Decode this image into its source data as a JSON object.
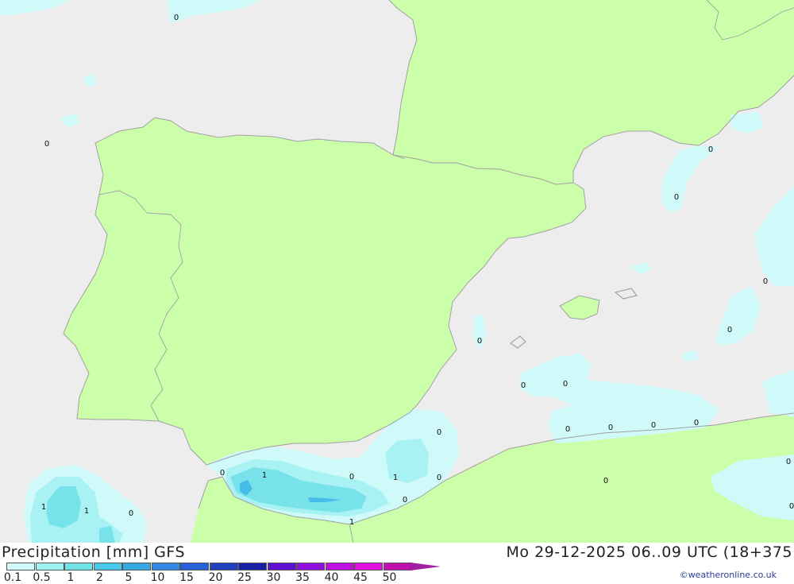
{
  "map": {
    "colors": {
      "sea": "#ededed",
      "land": "#ccffaa",
      "coast": "#a0a0a0",
      "precip_light": "#d0fafa",
      "precip_mid": "#a8f2f4",
      "precip_heavy": "#78e2ea",
      "precip_core": "#44bde8"
    },
    "contour_labels": [
      "0",
      "0",
      "0",
      "0",
      "0",
      "0",
      "0",
      "0",
      "0",
      "0",
      "0",
      "0",
      "0",
      "0",
      "0",
      "0",
      "0",
      "0",
      "0",
      "0",
      "0",
      "1",
      "1",
      "1",
      "1",
      "1",
      "0"
    ]
  },
  "footer": {
    "title": "Precipitation [mm] GFS",
    "datetime": "Mo 29-12-2025 06..09 UTC (18+375",
    "credit": "©weatheronline.co.uk"
  },
  "legend": {
    "labels": [
      "0.1",
      "0.5",
      "1",
      "2",
      "5",
      "10",
      "15",
      "20",
      "25",
      "30",
      "35",
      "40",
      "45",
      "50"
    ],
    "colors": [
      "#d0fafa",
      "#a0f0f0",
      "#70e4e4",
      "#48c8e8",
      "#38a8e0",
      "#3088e0",
      "#2860d8",
      "#2040c0",
      "#1820a8",
      "#6010d0",
      "#9010e0",
      "#c010e0",
      "#e010e0",
      "#c010b0"
    ],
    "arrow_color": "#a020a0"
  }
}
